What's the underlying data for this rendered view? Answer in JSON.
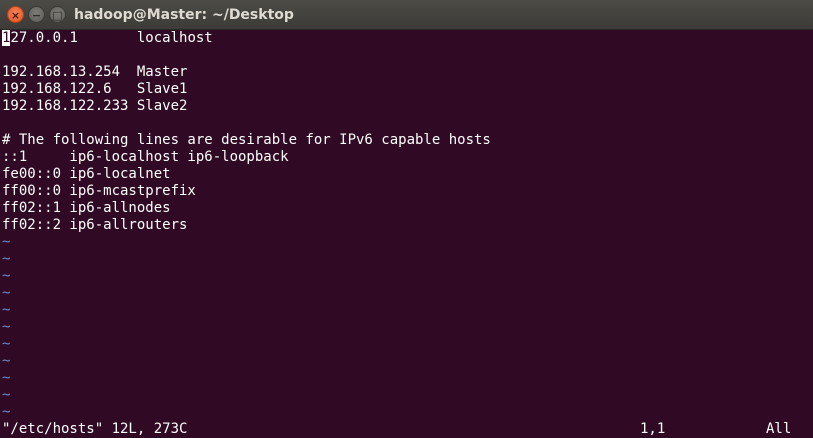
{
  "window": {
    "title": "hadoop@Master: ~/Desktop",
    "close_glyph": "×",
    "minimize_glyph": "−",
    "maximize_glyph": "□"
  },
  "editor": {
    "cursor_char": "1",
    "lines": [
      "27.0.0.1       localhost",
      "",
      "192.168.13.254  Master",
      "192.168.122.6   Slave1",
      "192.168.122.233 Slave2",
      "",
      "# The following lines are desirable for IPv6 capable hosts",
      "::1     ip6-localhost ip6-loopback",
      "fe00::0 ip6-localnet",
      "ff00::0 ip6-mcastprefix",
      "ff02::1 ip6-allnodes",
      "ff02::2 ip6-allrouters"
    ],
    "tilde": "~",
    "empty_line_count": 11
  },
  "status": {
    "file_info": "\"/etc/hosts\" 12L, 273C",
    "cursor_position": "1,1",
    "scroll_position": "All"
  },
  "colors": {
    "background": "#300a24",
    "text": "#ffffff",
    "tilde": "#6d86c8",
    "close_button": "#e2561f"
  }
}
